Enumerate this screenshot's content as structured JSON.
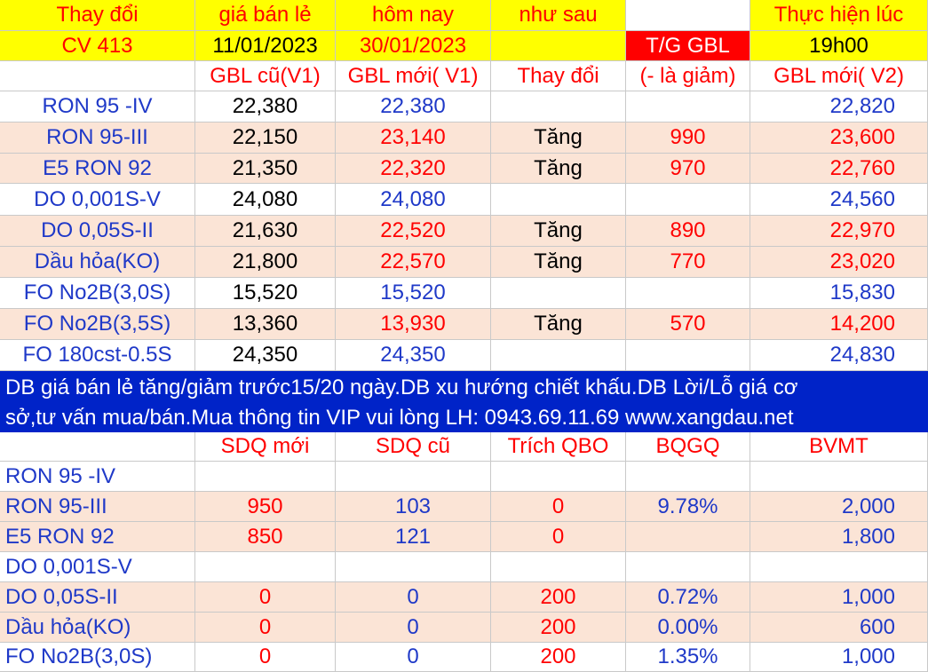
{
  "header": {
    "row1": [
      "Thay đổi",
      "giá bán lẻ",
      "hôm nay",
      "như sau",
      "",
      "Thực hiện lúc"
    ],
    "row2": [
      "CV 413",
      "11/01/2023",
      "30/01/2023",
      "",
      "T/G GBL",
      "19h00"
    ],
    "row3": [
      "",
      "GBL cũ(V1)",
      "GBL mới( V1)",
      "Thay đổi",
      "(- là giảm)",
      "GBL mới( V2)"
    ]
  },
  "price_rows": [
    {
      "name": "RON 95 -IV",
      "old": "22,380",
      "new": "22,380",
      "change": "",
      "delta": "",
      "v2": "22,820",
      "up": false
    },
    {
      "name": "RON 95-III",
      "old": "22,150",
      "new": "23,140",
      "change": "Tăng",
      "delta": "990",
      "v2": "23,600",
      "up": true
    },
    {
      "name": "E5 RON 92",
      "old": "21,350",
      "new": "22,320",
      "change": "Tăng",
      "delta": "970",
      "v2": "22,760",
      "up": true
    },
    {
      "name": "DO 0,001S-V",
      "old": "24,080",
      "new": "24,080",
      "change": "",
      "delta": "",
      "v2": "24,560",
      "up": false
    },
    {
      "name": "DO 0,05S-II",
      "old": "21,630",
      "new": "22,520",
      "change": "Tăng",
      "delta": "890",
      "v2": "22,970",
      "up": true
    },
    {
      "name": "Dầu hỏa(KO)",
      "old": "21,800",
      "new": "22,570",
      "change": "Tăng",
      "delta": "770",
      "v2": "23,020",
      "up": true
    },
    {
      "name": "FO No2B(3,0S)",
      "old": "15,520",
      "new": "15,520",
      "change": "",
      "delta": "",
      "v2": "15,830",
      "up": false
    },
    {
      "name": "FO No2B(3,5S)",
      "old": "13,360",
      "new": "13,930",
      "change": "Tăng",
      "delta": "570",
      "v2": "14,200",
      "up": true
    },
    {
      "name": "FO 180cst-0.5S",
      "old": "24,350",
      "new": "24,350",
      "change": "",
      "delta": "",
      "v2": "24,830",
      "up": false
    }
  ],
  "banner": {
    "line1": "DB giá bán lẻ tăng/giảm trước15/20 ngày.DB xu hướng chiết khấu.DB Lời/Lỗ giá cơ",
    "line2": "sở,tư vấn mua/bán.Mua thông tin VIP vui lòng LH: 0943.69.11.69 www.xangdau.net"
  },
  "fund_header": [
    "",
    "SDQ mới",
    "SDQ cũ",
    "Trích QBO",
    "BQGQ",
    "BVMT"
  ],
  "fund_rows": [
    {
      "name": "RON 95 -IV",
      "sdq_new": "",
      "sdq_old": "",
      "qbo": "",
      "bqgq": "",
      "bvmt": ""
    },
    {
      "name": "RON 95-III",
      "sdq_new": "950",
      "sdq_old": "103",
      "qbo": "0",
      "bqgq": "9.78%",
      "bvmt": "2,000"
    },
    {
      "name": "E5 RON 92",
      "sdq_new": "850",
      "sdq_old": "121",
      "qbo": "0",
      "bqgq": "",
      "bvmt": "1,800"
    },
    {
      "name": "DO 0,001S-V",
      "sdq_new": "",
      "sdq_old": "",
      "qbo": "",
      "bqgq": "",
      "bvmt": ""
    },
    {
      "name": "DO 0,05S-II",
      "sdq_new": "0",
      "sdq_old": "0",
      "qbo": "200",
      "bqgq": "0.72%",
      "bvmt": "1,000"
    },
    {
      "name": "Dầu hỏa(KO)",
      "sdq_new": "0",
      "sdq_old": "0",
      "qbo": "200",
      "bqgq": "0.00%",
      "bvmt": "600"
    },
    {
      "name": "FO No2B(3,0S)",
      "sdq_new": "0",
      "sdq_old": "0",
      "qbo": "200",
      "bqgq": "1.35%",
      "bvmt": "1,000"
    }
  ],
  "colors": {
    "red": "#ff0000",
    "blue": "#1f39c8",
    "yellow": "#ffff00",
    "banner": "#0023c8",
    "pink_row": "#fbe4d6"
  }
}
